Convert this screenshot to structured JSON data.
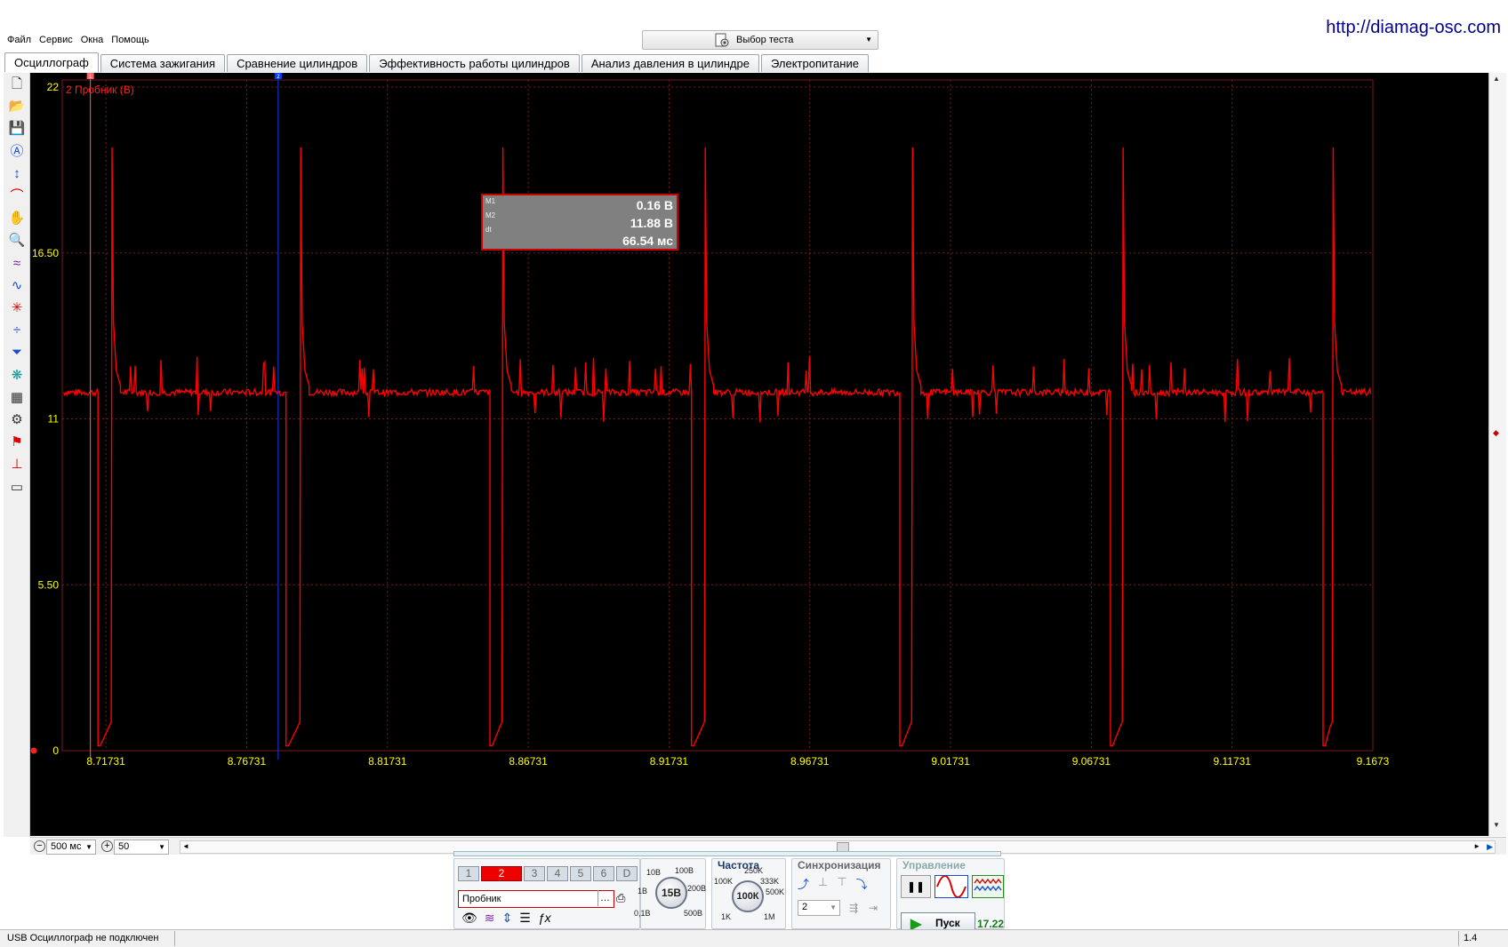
{
  "url": "http://diamag-osc.com",
  "menu": [
    "Файл",
    "Сервис",
    "Окна",
    "Помощь"
  ],
  "test_selector": {
    "label": "Выбор теста"
  },
  "tabs": [
    {
      "label": "Осциллограф",
      "active": true
    },
    {
      "label": "Система зажигания"
    },
    {
      "label": "Сравнение цилиндров"
    },
    {
      "label": "Эффективность работы цилиндров"
    },
    {
      "label": "Анализ давления в цилиндре"
    },
    {
      "label": "Электропитание"
    }
  ],
  "toolbar_icons": [
    "new-file-icon",
    "open-folder-icon",
    "save-icon",
    "auto-scale-icon",
    "vertical-cursor-icon",
    "measure-cursor-icon",
    "hand-pan-icon",
    "zoom-icon",
    "waves-icon",
    "waves-alt-icon",
    "spark-icon",
    "split-icon",
    "filter-icon",
    "bug-icon",
    "grid-icon",
    "auto-icon",
    "flag-icon",
    "zero-marker-icon",
    "page-icon"
  ],
  "scope": {
    "channel_label": "2 Пробник (В)",
    "y_ticks": [
      "22",
      "16.50",
      "11",
      "5.50",
      "0"
    ],
    "x_ticks": [
      "8.71731",
      "8.76731",
      "8.81731",
      "8.86731",
      "8.91731",
      "8.96731",
      "9.01731",
      "9.06731",
      "9.11731",
      "9.1673"
    ],
    "cursor1_label": "1",
    "cursor2_label": "2",
    "colors": {
      "trace": "#ff0000",
      "grid": "#7a1a1a",
      "axis_text": "#ffff00",
      "cursor1": "#ff6060",
      "cursor2": "#0040ff"
    }
  },
  "chart_data": {
    "type": "line",
    "ylim": [
      0,
      22
    ],
    "xlim": [
      8.7018,
      9.1673
    ],
    "x_ticks": [
      8.71731,
      8.76731,
      8.81731,
      8.86731,
      8.91731,
      8.96731,
      9.01731,
      9.06731,
      9.11731,
      9.1673
    ],
    "y_ticks": [
      0,
      5.5,
      11,
      16.5,
      22
    ],
    "series": [
      {
        "name": "2 Пробник (В)",
        "baseline": 11.88,
        "pulses": [
          {
            "t_drop": 8.7145,
            "t_spike": 8.7195,
            "spike": 20.0
          },
          {
            "t_drop": 8.7813,
            "t_spike": 8.7865,
            "spike": 20.0
          },
          {
            "t_drop": 8.8537,
            "t_spike": 8.8583,
            "spike": 20.0
          },
          {
            "t_drop": 8.9253,
            "t_spike": 8.9302,
            "spike": 20.0
          },
          {
            "t_drop": 8.9993,
            "t_spike": 9.0038,
            "spike": 20.0
          },
          {
            "t_drop": 9.0741,
            "t_spike": 9.0786,
            "spike": 20.0
          },
          {
            "t_drop": 9.1496,
            "t_spike": 9.1532,
            "spike": 20.0
          }
        ],
        "low": 0.16
      }
    ],
    "cursors": {
      "m1_t": 8.7118,
      "m2_t": 8.7785
    }
  },
  "measurement": {
    "m1_label": "M1",
    "m2_label": "M2",
    "dt_label": "dt",
    "m1_value": "0.16 В",
    "m2_value": "11.88 В",
    "dt_value": "66.54 мс"
  },
  "hbar": {
    "timebase": "500 мс",
    "zoom": "50"
  },
  "controls": {
    "channels": [
      "1",
      "2",
      "3",
      "4",
      "5",
      "6",
      "D"
    ],
    "active_channel": "2",
    "probe": "Пробник",
    "volt_knob": {
      "value": "15В",
      "labels": [
        "10В",
        "100В",
        "1В",
        "200В",
        "0,1В",
        "500В"
      ]
    },
    "freq": {
      "title": "Частота",
      "value": "100К",
      "labels": [
        "250K",
        "100K",
        "333K",
        "500K",
        "1K",
        "1M"
      ]
    },
    "sync": {
      "title": "Синхронизация",
      "channel": "2"
    },
    "control": {
      "title": "Управление",
      "start": "Пуск",
      "value": "17.22"
    }
  },
  "status": {
    "left": "USB Осциллограф не подключен",
    "right": "1.4"
  }
}
